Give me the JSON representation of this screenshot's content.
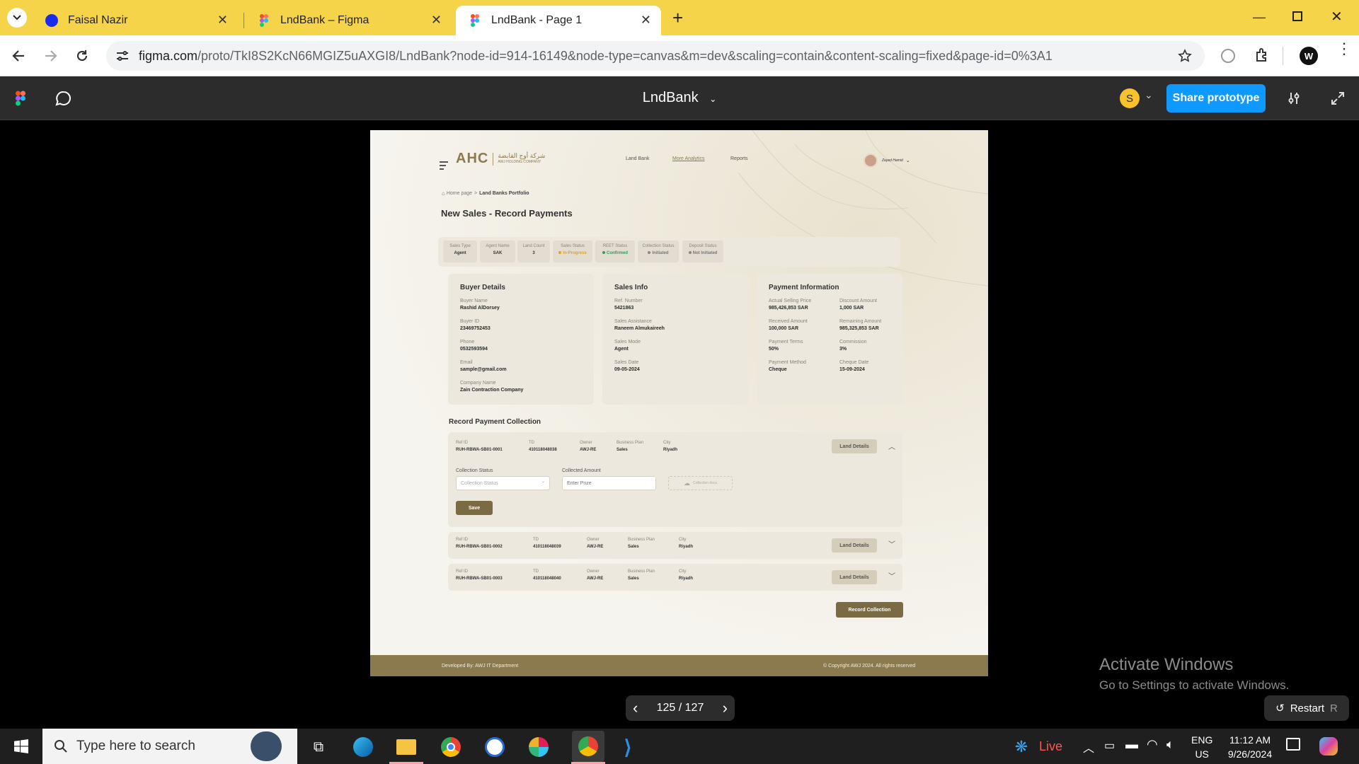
{
  "browser": {
    "tabs": [
      {
        "title": "Faisal Nazir",
        "icon": "blue-circle-icon",
        "active": false
      },
      {
        "title": "LndBank – Figma",
        "icon": "figma-icon",
        "active": false
      },
      {
        "title": "LndBank - Page 1",
        "icon": "figma-icon",
        "active": true
      }
    ],
    "url_host": "figma.com",
    "url_path": "/proto/TkI8S2KcN66MGIZ5uAXGI8/LndBank?node-id=914-16149&node-type=canvas&m=dev&scaling=contain&content-scaling=fixed&page-id=0%3A1"
  },
  "figma": {
    "file_title": "LndBank",
    "avatar_letter": "S",
    "share_label": "Share prototype",
    "page_counter": "125 / 127",
    "restart_label": "Restart",
    "restart_key": "R"
  },
  "app": {
    "logo": "AHC",
    "logo_ar": "شركة أوج القابضة",
    "logo_en": "AWJ HOLDING COMPANY",
    "nav": [
      "Land Bank",
      "More Analytics",
      "Reports"
    ],
    "user_name": "Zayed Hamid",
    "breadcrumb_home": "Home page",
    "breadcrumb_sep": ">",
    "breadcrumb_current": "Land Banks Portfolio",
    "page_title": "New Sales - Record Payments",
    "status_strip": [
      {
        "label": "Sales Type",
        "value": "Agent",
        "dot": ""
      },
      {
        "label": "Agent Name",
        "value": "SAK",
        "dot": ""
      },
      {
        "label": "Land Count",
        "value": "3",
        "dot": ""
      },
      {
        "label": "Sales Status",
        "value": "In-Progress",
        "dot": "#e8a020"
      },
      {
        "label": "REET Status",
        "value": "Confirmed",
        "dot": "#2f9e5a"
      },
      {
        "label": "Collection Status",
        "value": "Initiated",
        "dot": "#888888"
      },
      {
        "label": "Deposit Status",
        "value": "Not Initiated",
        "dot": "#888888"
      }
    ],
    "buyer": {
      "title": "Buyer Details",
      "fields": [
        {
          "label": "Buyer Name",
          "value": "Rashid AlDorsey"
        },
        {
          "label": "Buyer ID",
          "value": "23469752453"
        },
        {
          "label": "Phone",
          "value": "0532593594"
        },
        {
          "label": "Email",
          "value": "sample@gmail.com"
        },
        {
          "label": "Company Name",
          "value": "Zain Contraction Company"
        }
      ]
    },
    "sales": {
      "title": "Sales Info",
      "fields": [
        {
          "label": "Ref. Number",
          "value": "5421863"
        },
        {
          "label": "Sales Assistance",
          "value": "Raneem Almukaireeh"
        },
        {
          "label": "Sales Mode",
          "value": "Agent"
        },
        {
          "label": "Sales Date",
          "value": "09-05-2024"
        }
      ]
    },
    "payment": {
      "title": "Payment Information",
      "fields": [
        {
          "label": "Actual Selling Price",
          "value": "985,426,853 SAR"
        },
        {
          "label": "Discount Amount",
          "value": "1,000 SAR"
        },
        {
          "label": "Received Amount",
          "value": "100,000 SAR"
        },
        {
          "label": "Remaining Amount",
          "value": "985,325,853 SAR"
        },
        {
          "label": "Payment Terms",
          "value": "50%"
        },
        {
          "label": "Commission",
          "value": "3%"
        },
        {
          "label": "Payment Method",
          "value": "Cheque"
        },
        {
          "label": "Cheque Date",
          "value": "15-09-2024"
        }
      ]
    },
    "collection": {
      "title": "Record Payment Collection",
      "col_labels": [
        "Ref ID",
        "TD",
        "Owner",
        "Business Plan",
        "City"
      ],
      "rows": [
        {
          "ref": "RUH-RBWA-SB01-0001",
          "td": "410118048038",
          "owner": "AWJ-RE",
          "plan": "Sales",
          "city": "Riyadh"
        },
        {
          "ref": "RUH-RBWA-SB01-0002",
          "td": "410118048039",
          "owner": "AWJ-RE",
          "plan": "Sales",
          "city": "Riyadh"
        },
        {
          "ref": "RUH-RBWA-SB01-0003",
          "td": "410118048040",
          "owner": "AWJ-RE",
          "plan": "Sales",
          "city": "Riyadh"
        }
      ],
      "land_details_label": "Land Details",
      "collection_status_label": "Collection Status",
      "collection_status_placeholder": "Collection Status",
      "collected_amount_label": "Collected Amount",
      "collected_amount_placeholder": "Enter Prize",
      "upload_label": "Collection docs",
      "save_label": "Save",
      "record_label": "Record Collection"
    },
    "footer_left": "Developed By: AWJ IT Department",
    "footer_right": "© Copyright AWJ 2024. All rights reserved"
  },
  "windows": {
    "activate_title": "Activate Windows",
    "activate_sub": "Go to Settings to activate Windows.",
    "search_placeholder": "Type here to search",
    "live_label": "Live",
    "lang1": "ENG",
    "lang2": "US",
    "time": "11:12 AM",
    "date": "9/26/2024"
  }
}
